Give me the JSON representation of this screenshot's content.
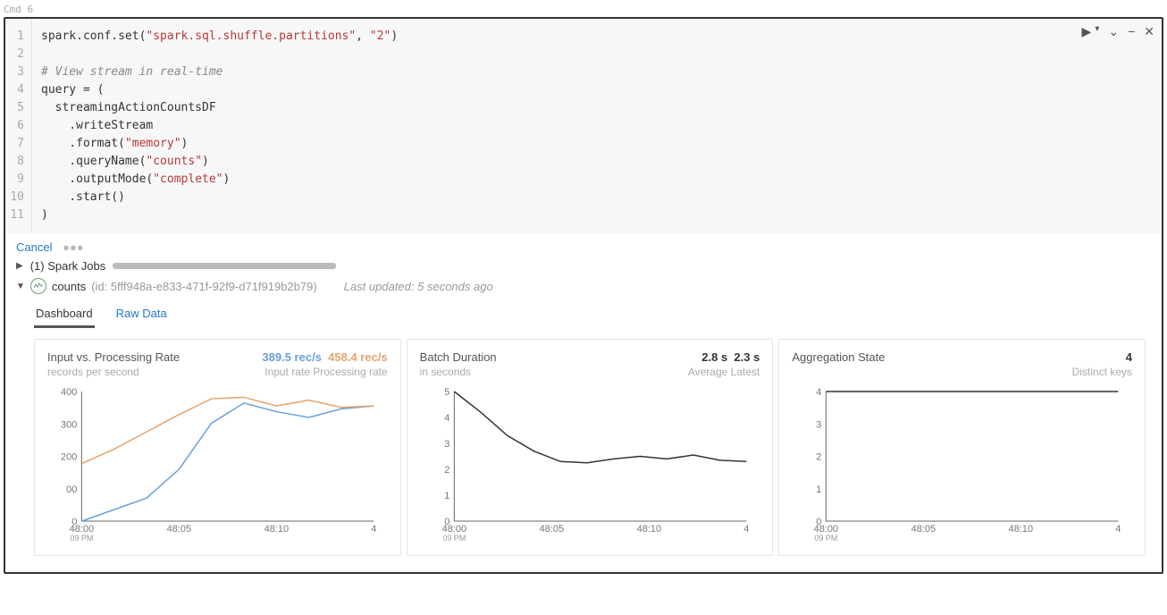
{
  "cmd_label": "Cmd 6",
  "code_lines": [
    {
      "n": "1",
      "html": "spark.conf.set(<span class='str'>\"spark.sql.shuffle.partitions\"</span>, <span class='str'>\"2\"</span>)"
    },
    {
      "n": "2",
      "html": ""
    },
    {
      "n": "3",
      "html": "<span class='comment'># View stream in real-time</span>"
    },
    {
      "n": "4",
      "html": "query = ("
    },
    {
      "n": "5",
      "html": "  streamingActionCountsDF"
    },
    {
      "n": "6",
      "html": "    .writeStream"
    },
    {
      "n": "7",
      "html": "    .format(<span class='str'>\"memory\"</span>)"
    },
    {
      "n": "8",
      "html": "    .queryName(<span class='str'>\"counts\"</span>)"
    },
    {
      "n": "9",
      "html": "    .outputMode(<span class='str'>\"complete\"</span>)"
    },
    {
      "n": "10",
      "html": "    .start()"
    },
    {
      "n": "11",
      "html": ")"
    }
  ],
  "cancel_label": "Cancel",
  "spark_jobs_label": "(1) Spark Jobs",
  "stream_name": "counts",
  "stream_id": "(id: 5fff948a-e833-471f-92f9-d71f919b2b79)",
  "last_updated": "Last updated: 5 seconds ago",
  "tabs": {
    "dashboard": "Dashboard",
    "rawdata": "Raw Data"
  },
  "chart_data": [
    {
      "type": "line",
      "title": "Input vs. Processing Rate",
      "subtitle": "records per second",
      "metrics_header": {
        "val1": "389.5 rec/s",
        "val2": "458.4 rec/s",
        "lab1": "Input rate",
        "lab2": "Processing rate"
      },
      "x_ticks": [
        "48:00",
        "48:05",
        "48:10",
        "4"
      ],
      "x_subticks": [
        "09 PM"
      ],
      "y_ticks": [
        "0",
        "00",
        "200",
        "300",
        "400"
      ],
      "ylim": [
        0,
        450
      ],
      "series": [
        {
          "name": "Input rate",
          "color": "#6aa0d8",
          "values": [
            0,
            40,
            80,
            180,
            340,
            410,
            380,
            360,
            390,
            400
          ]
        },
        {
          "name": "Processing rate",
          "color": "#e4a36b",
          "values": [
            200,
            250,
            310,
            370,
            425,
            430,
            400,
            420,
            395,
            400
          ]
        }
      ]
    },
    {
      "type": "line",
      "title": "Batch Duration",
      "subtitle": "in seconds",
      "metrics_header": {
        "val1": "2.8 s",
        "val2": "2.3 s",
        "lab1": "Average",
        "lab2": "Latest"
      },
      "x_ticks": [
        "48:00",
        "48:05",
        "48:10",
        "4"
      ],
      "x_subticks": [
        "09 PM"
      ],
      "y_ticks": [
        "0",
        "1",
        "2",
        "3",
        "4",
        "5"
      ],
      "ylim": [
        0,
        5
      ],
      "series": [
        {
          "name": "Batch Duration",
          "color": "#333",
          "values": [
            5.0,
            4.2,
            3.3,
            2.7,
            2.3,
            2.25,
            2.4,
            2.5,
            2.4,
            2.55,
            2.35,
            2.3
          ]
        }
      ]
    },
    {
      "type": "line",
      "title": "Aggregation State",
      "subtitle": "",
      "metrics_header": {
        "val1": "4",
        "val2": "",
        "lab1": "Distinct keys",
        "lab2": ""
      },
      "x_ticks": [
        "48:00",
        "48:05",
        "48:10",
        "4"
      ],
      "x_subticks": [
        "09 PM"
      ],
      "y_ticks": [
        "0",
        "1",
        "2",
        "3",
        "4"
      ],
      "ylim": [
        0,
        4
      ],
      "series": [
        {
          "name": "Distinct keys",
          "color": "#333",
          "values": [
            4,
            4,
            4,
            4,
            4,
            4,
            4,
            4,
            4,
            4
          ]
        }
      ]
    }
  ]
}
